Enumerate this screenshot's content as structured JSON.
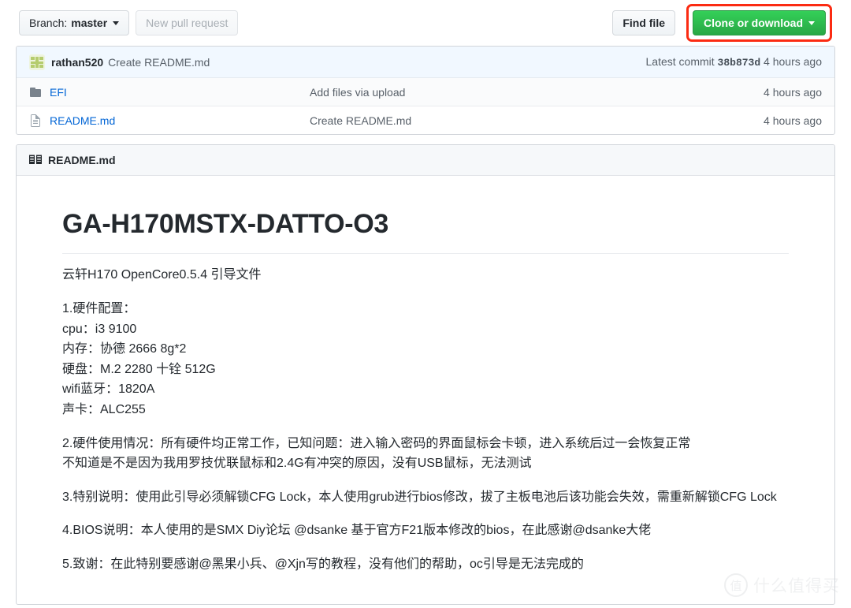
{
  "toolbar": {
    "branch_prefix": "Branch: ",
    "branch_name": "master",
    "new_pull_request": "New pull request",
    "find_file": "Find file",
    "clone_or_download": "Clone or download",
    "annotation_color": "#fb2b12",
    "green_color": "#28a745"
  },
  "commit_bar": {
    "author": "rathan520",
    "message": "Create README.md",
    "latest_commit_label": "Latest commit",
    "sha": "38b873d",
    "age": "4 hours ago"
  },
  "files": [
    {
      "icon": "folder-icon",
      "name": "EFI",
      "message": "Add files via upload",
      "age": "4 hours ago"
    },
    {
      "icon": "file-icon",
      "name": "README.md",
      "message": "Create README.md",
      "age": "4 hours ago"
    }
  ],
  "readme": {
    "header_title": "README.md",
    "header_icon": "book-icon",
    "title": "GA-H170MSTX-DATTO-O3",
    "intro": "云轩H170 OpenCore0.5.4 引导文件",
    "section1_title": "1.硬件配置：",
    "spec_cpu": "cpu：i3 9100",
    "spec_memory": "内存：协德 2666 8g*2",
    "spec_disk": "硬盘：M.2 2280 十铨 512G",
    "spec_wifi": "wifi蓝牙：1820A",
    "spec_audio": "声卡：ALC255",
    "section2_line1": "2.硬件使用情况：所有硬件均正常工作，已知问题：进入输入密码的界面鼠标会卡顿，进入系统后过一会恢复正常",
    "section2_line2": "不知道是不是因为我用罗技优联鼠标和2.4G有冲突的原因，没有USB鼠标，无法测试",
    "section3": "3.特别说明：使用此引导必须解锁CFG Lock，本人使用grub进行bios修改，拔了主板电池后该功能会失效，需重新解锁CFG Lock",
    "section4": "4.BIOS说明：本人使用的是SMX Diy论坛 @dsanke 基于官方F21版本修改的bios，在此感谢@dsanke大佬",
    "section5": "5.致谢：在此特别要感谢@黑果小兵、@Xjn写的教程，没有他们的帮助，oc引导是无法完成的"
  },
  "watermark": {
    "mark": "值",
    "text": "什么值得买"
  }
}
